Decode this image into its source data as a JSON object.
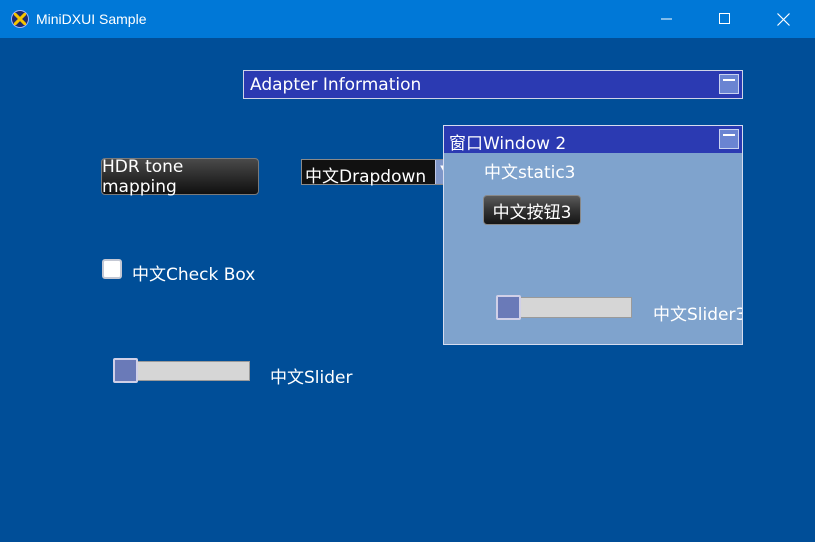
{
  "window": {
    "title": "MiniDXUI Sample",
    "icon": "x-logo-icon",
    "controls": [
      "minimize-icon",
      "maximize-icon",
      "close-icon"
    ]
  },
  "adapter_panel": {
    "label": "Adapter Information"
  },
  "hdr_button": {
    "label": "HDR tone mapping"
  },
  "dropdown": {
    "value": "中文Drapdown"
  },
  "checkbox": {
    "label": "中文Check Box",
    "checked": false
  },
  "slider": {
    "label": "中文Slider",
    "value_fraction": 0.0
  },
  "window2": {
    "title": "窗口Window 2",
    "static_text": "中文static3",
    "button_label": "中文按钮3",
    "slider_label": "中文Slider3",
    "slider_value_fraction": 0.0
  },
  "colors": {
    "background": "#004e98",
    "titlebar": "#0078d7",
    "panel_header": "#2b3ab2",
    "window2_body": "#7fa3cd"
  }
}
